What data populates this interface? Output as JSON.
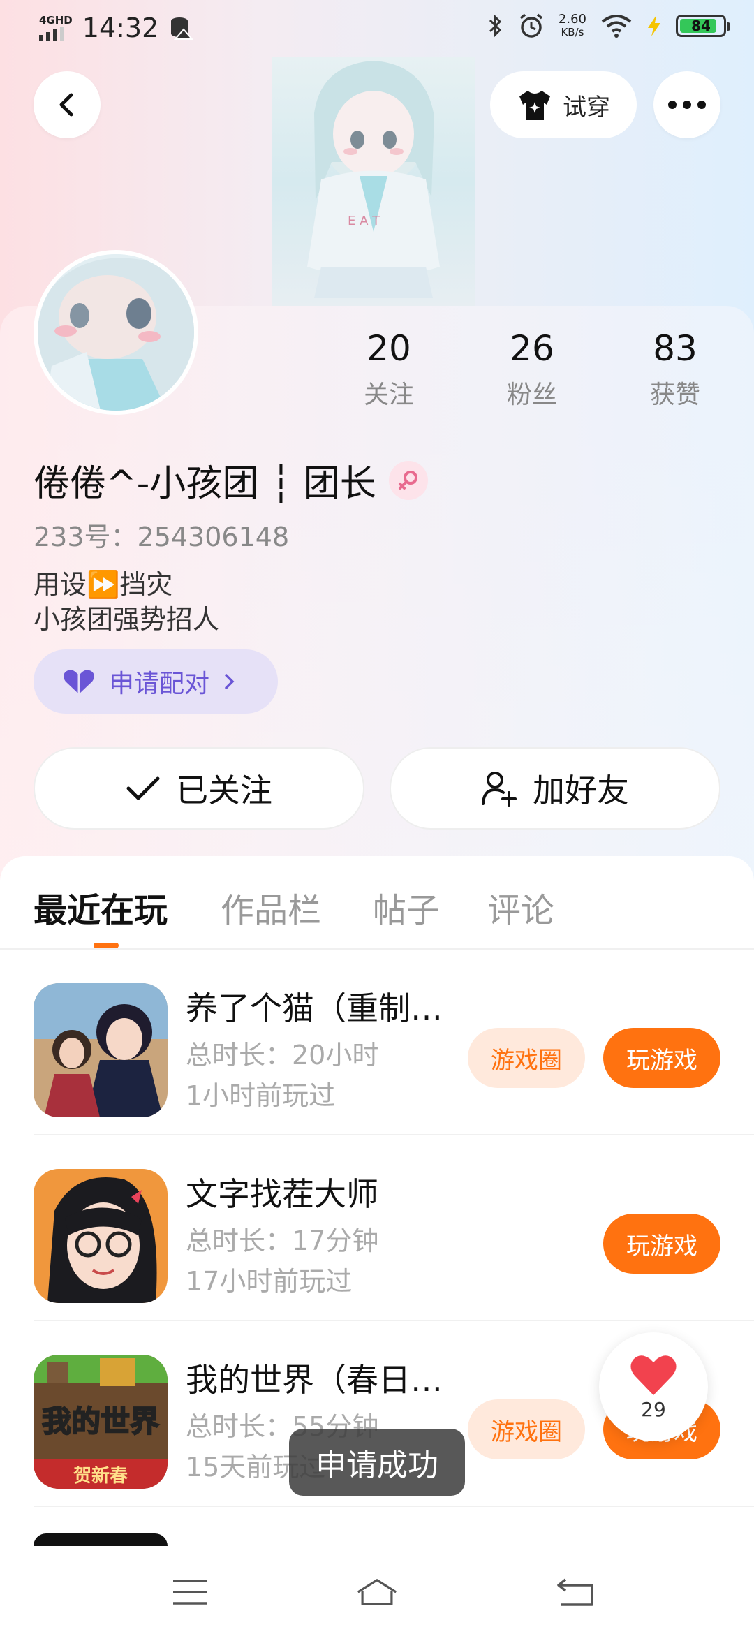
{
  "status_bar": {
    "network": "4GHD",
    "time": "14:32",
    "speed_value": "2.60",
    "speed_unit": "KB/s",
    "battery": "84"
  },
  "header": {
    "try_on_label": "试穿"
  },
  "profile": {
    "stats": [
      {
        "value": "20",
        "label": "关注"
      },
      {
        "value": "26",
        "label": "粉丝"
      },
      {
        "value": "83",
        "label": "获赞"
      }
    ],
    "name": "倦倦^-小孩团 ┆ 团长",
    "uid": "233号：254306148",
    "bio_line1": "用设⏩挡灾",
    "bio_line2": "小孩团强势招人",
    "pair_button": "申请配对",
    "follow_button": "已关注",
    "add_friend_button": "加好友"
  },
  "tabs": [
    "最近在玩",
    "作品栏",
    "帖子",
    "评论"
  ],
  "games": [
    {
      "title": "养了个猫（重制…",
      "duration": "总时长：20小时",
      "last_played": "1小时前玩过",
      "circle_button": "游戏圈",
      "play_button": "玩游戏"
    },
    {
      "title": "文字找茬大师",
      "duration": "总时长：17分钟",
      "last_played": "17小时前玩过",
      "circle_button": "",
      "play_button": "玩游戏"
    },
    {
      "title": "我的世界（春日…",
      "duration": "总时长：55分钟",
      "last_played": "15天前玩过",
      "circle_button": "游戏圈",
      "play_button": "玩游戏",
      "icon_text_1": "我的世界",
      "icon_text_2": "贺新春"
    }
  ],
  "floating_like": {
    "count": "29"
  },
  "toast": "申请成功",
  "colors": {
    "accent": "#ff7210",
    "pair_purple": "#6a55d6",
    "pair_bg": "#e6e1f7"
  }
}
